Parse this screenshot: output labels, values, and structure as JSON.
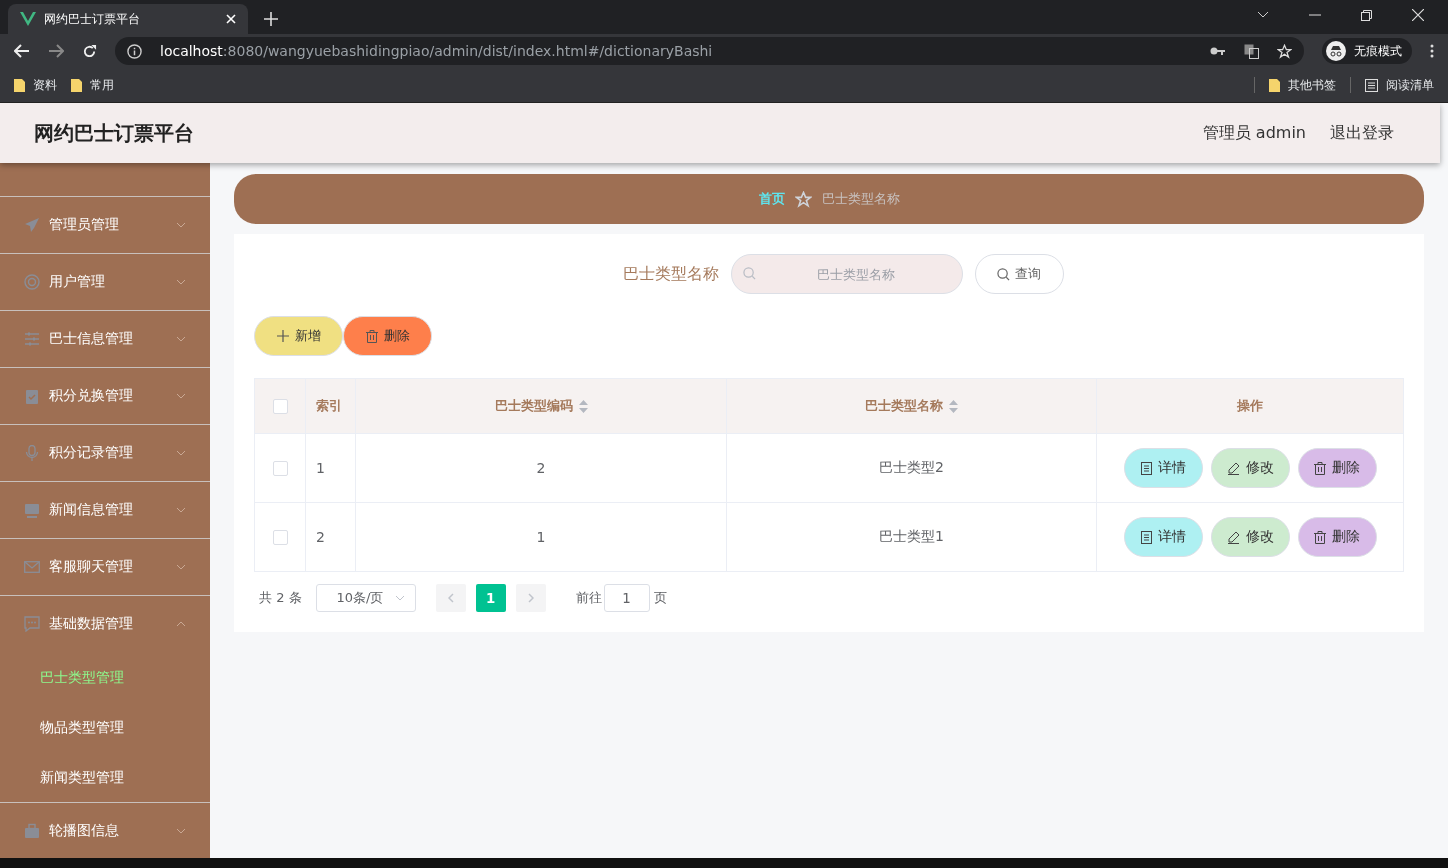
{
  "browser": {
    "tab_title": "网约巴士订票平台",
    "url_host": "localhost",
    "url_rest": ":8080/wangyuebashidingpiao/admin/dist/index.html#/dictionaryBashi",
    "profile": "无痕模式",
    "bookmarks": [
      "资料",
      "常用"
    ],
    "other_bookmarks": "其他书签",
    "reading_list": "阅读清单"
  },
  "header": {
    "title": "网约巴士订票平台",
    "user": "管理员 admin",
    "logout": "退出登录"
  },
  "sidebar": {
    "items": [
      {
        "label": "管理员管理",
        "expanded": false
      },
      {
        "label": "用户管理",
        "expanded": false
      },
      {
        "label": "巴士信息管理",
        "expanded": false
      },
      {
        "label": "积分兑换管理",
        "expanded": false
      },
      {
        "label": "积分记录管理",
        "expanded": false
      },
      {
        "label": "新闻信息管理",
        "expanded": false
      },
      {
        "label": "客服聊天管理",
        "expanded": false
      },
      {
        "label": "基础数据管理",
        "expanded": true,
        "children": [
          {
            "label": "巴士类型管理",
            "selected": true
          },
          {
            "label": "物品类型管理",
            "selected": false
          },
          {
            "label": "新闻类型管理",
            "selected": false
          }
        ]
      },
      {
        "label": "轮播图信息",
        "expanded": false
      }
    ]
  },
  "breadcrumb": {
    "home": "首页",
    "current": "巴士类型名称"
  },
  "search": {
    "label": "巴士类型名称",
    "placeholder": "巴士类型名称",
    "button": "查询"
  },
  "actions": [
    {
      "label": "新增",
      "kind": "add"
    },
    {
      "label": "删除",
      "kind": "delete"
    }
  ],
  "table": {
    "header_checked": false,
    "columns": [
      {
        "label": "索引",
        "sortable": false
      },
      {
        "label": "巴士类型编码",
        "sortable": true
      },
      {
        "label": "巴士类型名称",
        "sortable": true
      },
      {
        "label": "操作",
        "sortable": false
      }
    ],
    "rows": [
      {
        "checked": false,
        "cells": [
          "1",
          "2",
          "巴士类型2"
        ],
        "buttons": [
          {
            "label": "详情",
            "kind": "detail"
          },
          {
            "label": "修改",
            "kind": "edit"
          },
          {
            "label": "删除",
            "kind": "delete"
          }
        ]
      },
      {
        "checked": false,
        "cells": [
          "2",
          "1",
          "巴士类型1"
        ],
        "buttons": [
          {
            "label": "详情",
            "kind": "detail"
          },
          {
            "label": "修改",
            "kind": "edit"
          },
          {
            "label": "删除",
            "kind": "delete"
          }
        ]
      }
    ]
  },
  "pagination": {
    "total": "共 2 条",
    "page_size": "10条/页",
    "pages": [
      {
        "label": "1",
        "selected": true
      }
    ],
    "goto_label": "前往",
    "goto_value": "1",
    "page_suffix": "页"
  }
}
